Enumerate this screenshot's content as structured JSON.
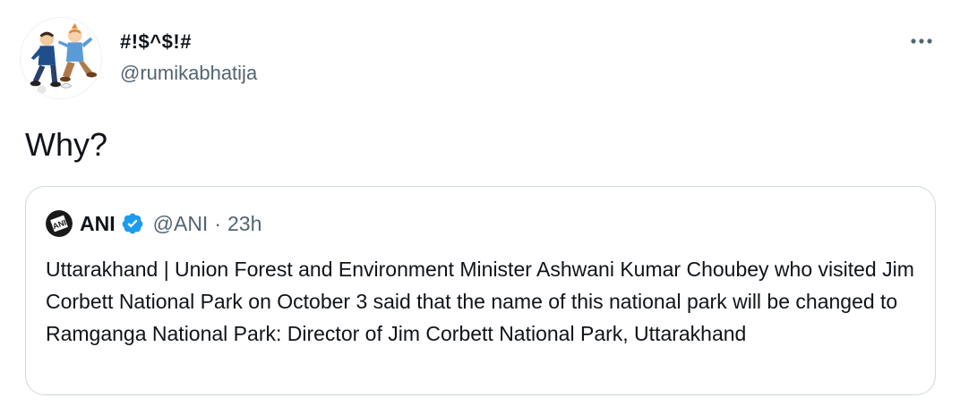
{
  "tweet": {
    "display_name": "#!$^$!#",
    "handle": "@rumikabhatija",
    "text": "Why?",
    "avatar_icon": "tintin-avatar-icon",
    "more_icon": "more-options-icon"
  },
  "quoted_tweet": {
    "display_name": "ANI",
    "handle": "@ANI",
    "separator": "·",
    "time": "23h",
    "avatar_icon": "ani-logo-icon",
    "verified_icon": "verified-badge-icon",
    "text": "Uttarakhand | Union Forest and Environment Minister Ashwani Kumar Choubey who visited Jim Corbett National Park on October 3 said that the name of this national park will be changed to Ramganga National Park: Director of Jim Corbett National Park, Uttarakhand"
  },
  "colors": {
    "text_primary": "#0f1419",
    "text_secondary": "#536471",
    "border": "#cfd9de",
    "verified": "#1d9bf0"
  }
}
